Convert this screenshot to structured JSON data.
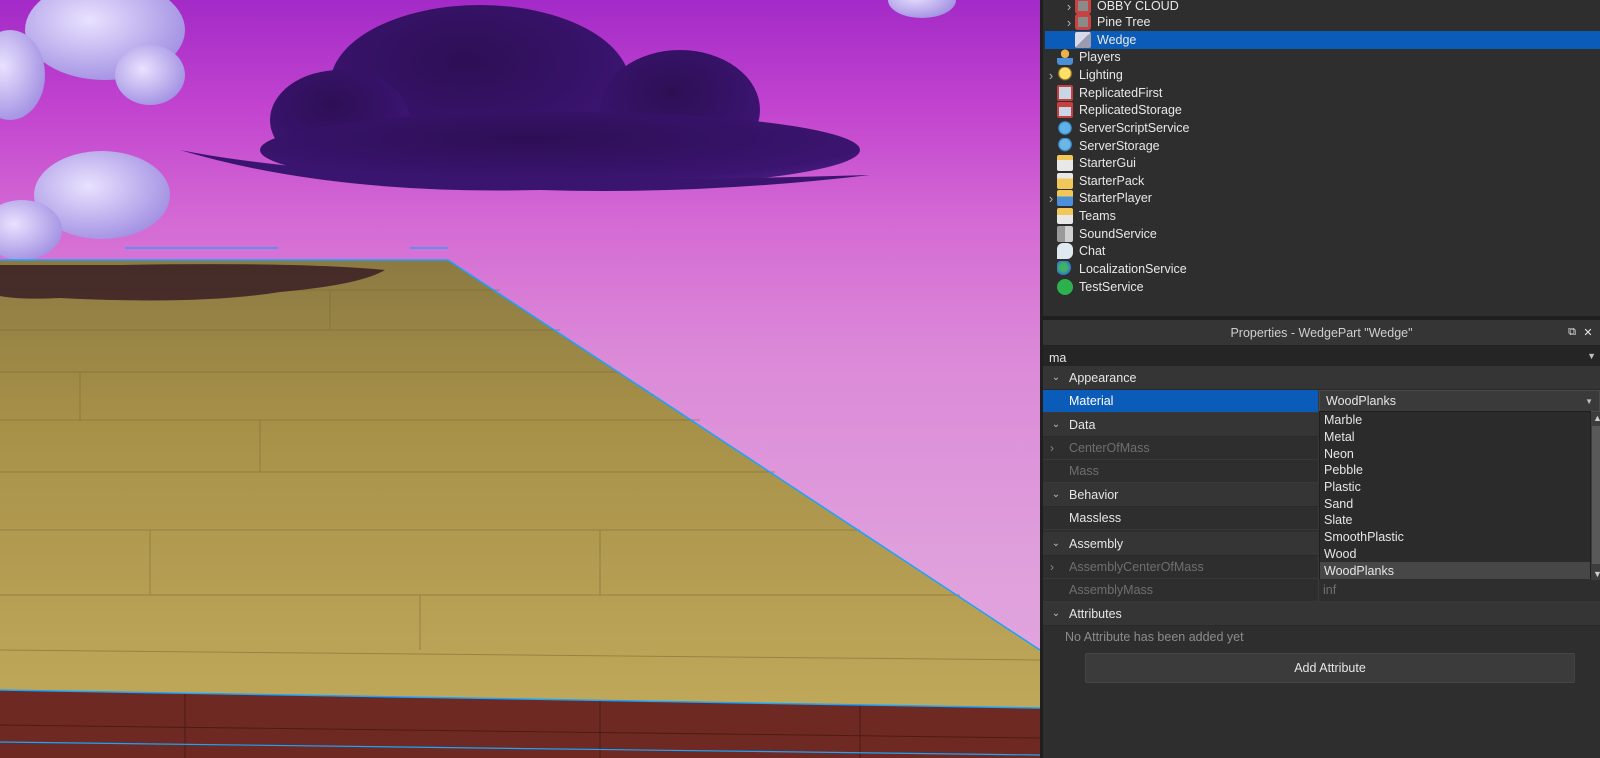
{
  "explorer": {
    "items": [
      {
        "label": "OBBY CLOUD",
        "icon": "model-icon",
        "expandable": true,
        "selected": false
      },
      {
        "label": "Pine Tree",
        "icon": "model-icon",
        "expandable": true,
        "selected": false
      },
      {
        "label": "Wedge",
        "icon": "wedge-part-icon",
        "expandable": false,
        "selected": true
      },
      {
        "label": "Players",
        "icon": "players-icon",
        "expandable": false,
        "selected": false
      },
      {
        "label": "Lighting",
        "icon": "lightbulb-icon",
        "expandable": true,
        "selected": false
      },
      {
        "label": "ReplicatedFirst",
        "icon": "replicated-first-icon",
        "expandable": false,
        "selected": false
      },
      {
        "label": "ReplicatedStorage",
        "icon": "replicated-storage-icon",
        "expandable": false,
        "selected": false
      },
      {
        "label": "ServerScriptService",
        "icon": "server-script-service-icon",
        "expandable": false,
        "selected": false
      },
      {
        "label": "ServerStorage",
        "icon": "server-storage-icon",
        "expandable": false,
        "selected": false
      },
      {
        "label": "StarterGui",
        "icon": "starter-gui-icon",
        "expandable": false,
        "selected": false
      },
      {
        "label": "StarterPack",
        "icon": "starter-pack-icon",
        "expandable": false,
        "selected": false
      },
      {
        "label": "StarterPlayer",
        "icon": "starter-player-icon",
        "expandable": true,
        "selected": false
      },
      {
        "label": "Teams",
        "icon": "teams-icon",
        "expandable": false,
        "selected": false
      },
      {
        "label": "SoundService",
        "icon": "sound-service-icon",
        "expandable": false,
        "selected": false
      },
      {
        "label": "Chat",
        "icon": "chat-icon",
        "expandable": false,
        "selected": false
      },
      {
        "label": "LocalizationService",
        "icon": "globe-icon",
        "expandable": false,
        "selected": false
      },
      {
        "label": "TestService",
        "icon": "check-icon",
        "expandable": false,
        "selected": false
      }
    ]
  },
  "properties": {
    "title": "Properties - WedgePart \"Wedge\"",
    "filter_value": "ma",
    "categories": {
      "appearance": "Appearance",
      "data": "Data",
      "behavior": "Behavior",
      "assembly": "Assembly",
      "attributes": "Attributes"
    },
    "rows": {
      "material": {
        "name": "Material",
        "value": "WoodPlanks"
      },
      "center_of_mass": {
        "name": "CenterOfMass"
      },
      "mass": {
        "name": "Mass"
      },
      "massless": {
        "name": "Massless"
      },
      "assembly_center_of_mass": {
        "name": "AssemblyCenterOfMass"
      },
      "assembly_mass": {
        "name": "AssemblyMass",
        "value": "inf"
      }
    },
    "material_options": [
      "Marble",
      "Metal",
      "Neon",
      "Pebble",
      "Plastic",
      "Sand",
      "Slate",
      "SmoothPlastic",
      "Wood",
      "WoodPlanks"
    ],
    "material_selected": "WoodPlanks",
    "no_attributes_text": "No Attribute has been added yet",
    "add_attribute_label": "Add Attribute"
  },
  "colors": {
    "selection": "#0b5cb8",
    "panel_bg": "#2e2e2e",
    "sky_top": "#a32ac7",
    "sky_bottom": "#e3a9de",
    "wood": "#b39a4f",
    "wood_edge": "#6e2a22",
    "selection_outline": "#1aa3ff"
  }
}
